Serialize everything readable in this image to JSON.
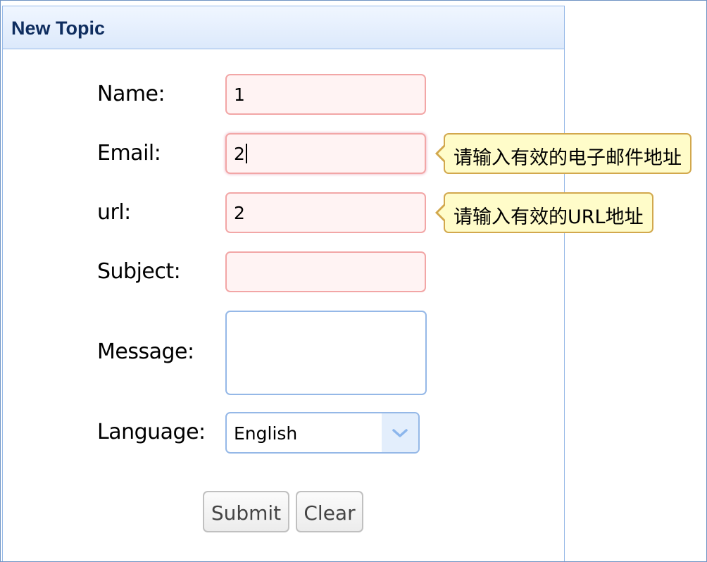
{
  "panel": {
    "title": "New Topic"
  },
  "form": {
    "name": {
      "label": "Name:",
      "value": "1"
    },
    "email": {
      "label": "Email:",
      "value": "2",
      "error": "请输入有效的电子邮件地址"
    },
    "url": {
      "label": "url:",
      "value": "2",
      "error": "请输入有效的URL地址"
    },
    "subject": {
      "label": "Subject:",
      "value": ""
    },
    "message": {
      "label": "Message:",
      "value": ""
    },
    "language": {
      "label": "Language:",
      "selected": "English"
    }
  },
  "buttons": {
    "submit": "Submit",
    "clear": "Clear"
  },
  "colors": {
    "invalid_border": "#f2a6a6",
    "invalid_bg": "#fff3f3",
    "tooltip_bg": "#fffcc9",
    "tooltip_border": "#d2a84d",
    "panel_border": "#95b8e7",
    "title": "#0e2d5f"
  },
  "icons": {
    "select_arrow": "chevron-down-icon"
  }
}
